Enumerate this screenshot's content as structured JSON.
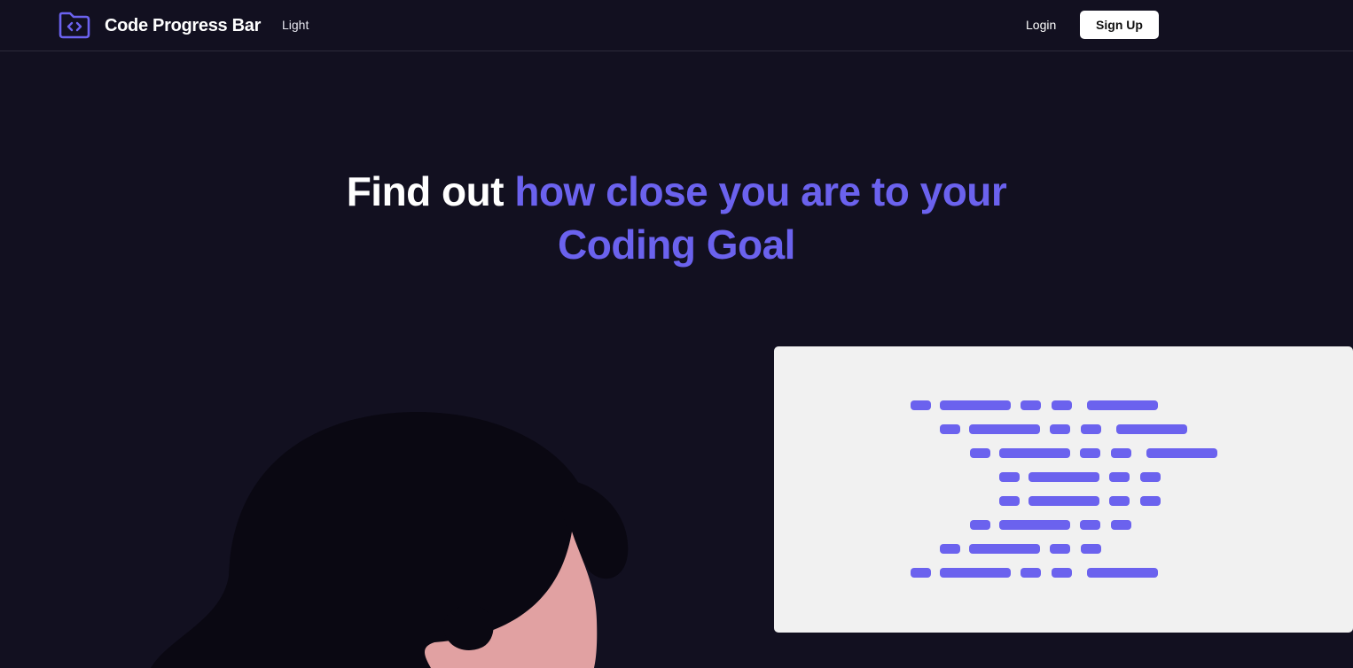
{
  "header": {
    "logo_icon": "folder-code-icon",
    "brand": "Code Progress Bar",
    "theme_toggle": "Light",
    "login": "Login",
    "signup": "Sign Up"
  },
  "hero": {
    "headline_plain": "Find out ",
    "headline_accent_line1": "how close you are to your",
    "headline_accent_line2": "Coding Goal"
  },
  "colors": {
    "background": "#121020",
    "accent": "#6b62ee",
    "panel": "#f1f1f1",
    "skin": "#e1a1a2",
    "hair": "#0a0812"
  }
}
